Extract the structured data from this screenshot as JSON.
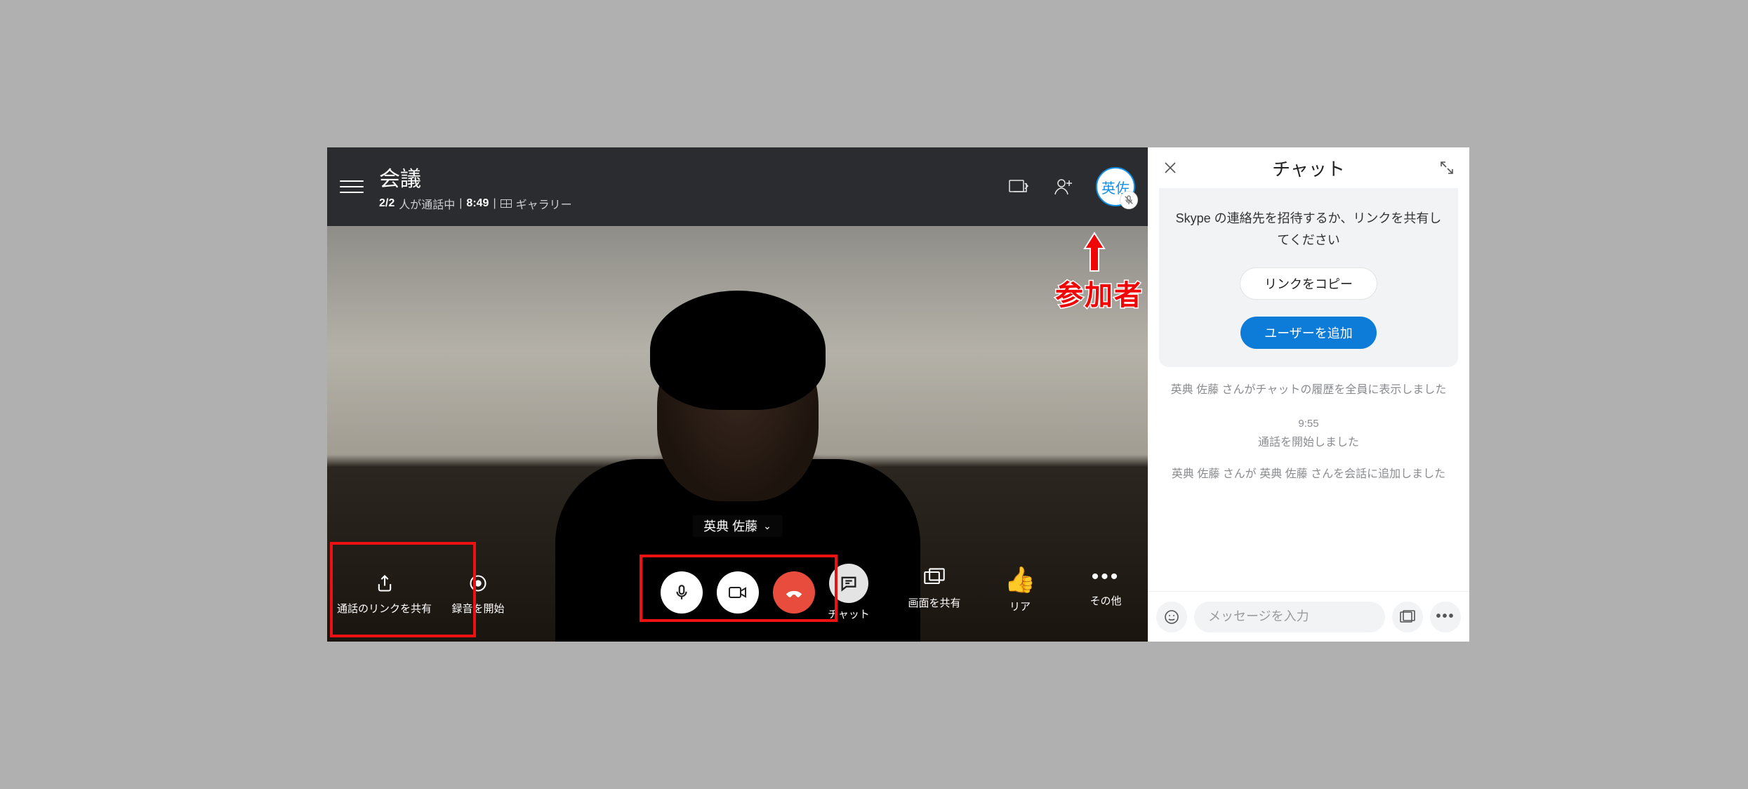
{
  "header": {
    "title": "会議",
    "participants_ratio": "2/2",
    "status_label": "人が通話中",
    "duration": "8:49",
    "view_label": "ギャラリー",
    "self_avatar_initials": "英佐"
  },
  "participant_label": "英典 佐藤",
  "controls": {
    "share_link": "通話のリンクを共有",
    "start_record": "録音を開始",
    "chat": "チャット",
    "share_screen": "画面を共有",
    "reaction": "リア",
    "more": "その他"
  },
  "annotation": {
    "label": "参加者"
  },
  "chat": {
    "title": "チャット",
    "invite_text": "Skype の連絡先を招待するか、リンクを共有してください",
    "copy_link": "リンクをコピー",
    "add_user": "ユーザーを追加",
    "sys1": "英典 佐藤 さんがチャットの履歴を全員に表示しました",
    "time": "9:55",
    "sys2": "通話を開始しました",
    "sys3": "英典 佐藤 さんが 英典 佐藤 さんを会話に追加しました",
    "input_placeholder": "メッセージを入力"
  }
}
